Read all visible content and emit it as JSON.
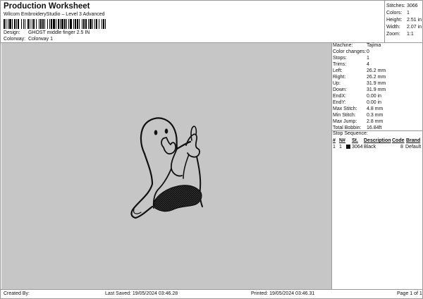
{
  "header": {
    "title": "Production Worksheet",
    "subtitle": "Wilcom EmbroideryStudio – Level 3 Advanced"
  },
  "design": {
    "label": "Design:",
    "value": "GHOST middle finger 2.5 IN"
  },
  "colorway": {
    "label": "Colorway:",
    "value": "Colorway 1"
  },
  "summary": [
    {
      "label": "Stitches:",
      "value": "3066"
    },
    {
      "label": "Colors:",
      "value": "1"
    },
    {
      "label": "Height:",
      "value": "2.51 in"
    },
    {
      "label": "Width:",
      "value": "2.07 in"
    },
    {
      "label": "Zoom:",
      "value": "1:1"
    }
  ],
  "machine": [
    {
      "label": "Machine:",
      "value": "Tajima"
    },
    {
      "label": "Color changes:",
      "value": "0"
    },
    {
      "label": "Stops:",
      "value": "1"
    },
    {
      "label": "Trims:",
      "value": "4"
    },
    {
      "label": "Left:",
      "value": "26.2 mm"
    },
    {
      "label": "Right:",
      "value": "26.2 mm"
    },
    {
      "label": "Up:",
      "value": "31.9 mm"
    },
    {
      "label": "Down:",
      "value": "31.9 mm"
    },
    {
      "label": "EndX:",
      "value": "0.00 in"
    },
    {
      "label": "EndY:",
      "value": "0.00 in"
    },
    {
      "label": "Max Stitch:",
      "value": "4.8 mm"
    },
    {
      "label": "Min Stitch:",
      "value": "0.3 mm"
    },
    {
      "label": "Max Jump:",
      "value": "2.8 mm"
    },
    {
      "label": "Total Bobbin:",
      "value": "16.84ft"
    }
  ],
  "stop_sequence": {
    "title": "Stop Sequence:",
    "headers": {
      "num": "#",
      "n": "N#",
      "st": "St.",
      "description": "Description",
      "code": "Code",
      "brand": "Brand"
    },
    "rows": [
      {
        "num": "1",
        "n": "1",
        "color": "#111111",
        "st": "3064",
        "description": "Black",
        "code": "8",
        "brand": "Default"
      }
    ]
  },
  "footer": {
    "created_by": "Created By:",
    "last_saved": "Last Saved: 19/05/2024 03:46.28",
    "printed": "Printed: 19/05/2024 03:46.31",
    "page": "Page 1 of 1"
  },
  "colors": {
    "canvas": "#c6c6c6",
    "thread": "#111111"
  }
}
